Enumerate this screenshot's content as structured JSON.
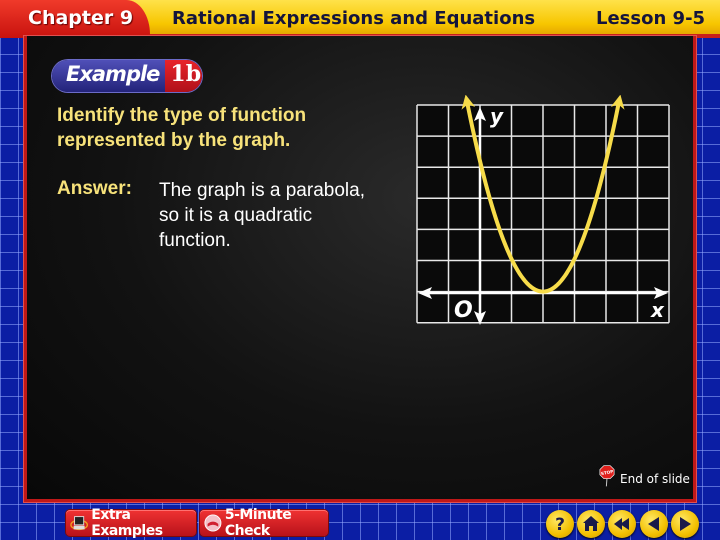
{
  "header": {
    "chapter": "Chapter 9",
    "title": "Rational Expressions and Equations",
    "lesson": "Lesson 9-5"
  },
  "example": {
    "word": "Example",
    "number": "1b"
  },
  "question": "Identify the type of function represented by the graph.",
  "answer": {
    "label": "Answer:",
    "text": "The graph is a parabola, so it is a quadratic function."
  },
  "graph": {
    "x_axis_label": "x",
    "y_axis_label": "y",
    "origin_label": "O",
    "curve": "parabola",
    "curve_color": "#f7dc4a",
    "vertex": [
      2,
      0
    ],
    "grid_columns": 8,
    "grid_rows": 7
  },
  "end_of_slide": {
    "icon": "stop-sign-icon",
    "label": "End of slide"
  },
  "bottom_bar": {
    "extra_examples": "Extra Examples",
    "five_minute_check": "5-Minute Check",
    "nav_buttons": [
      {
        "name": "help-button",
        "icon": "question-icon",
        "glyph": "?"
      },
      {
        "name": "home-button",
        "icon": "home-icon"
      },
      {
        "name": "first-slide-button",
        "icon": "rewind-icon"
      },
      {
        "name": "previous-slide-button",
        "icon": "previous-icon"
      },
      {
        "name": "next-slide-button",
        "icon": "next-icon"
      }
    ]
  },
  "colors": {
    "header_yellow": "#f7c600",
    "chapter_red": "#d81a14",
    "frame_blue": "#0b1ea4",
    "question_text": "#f7e27a",
    "panel_border": "#c01818"
  }
}
